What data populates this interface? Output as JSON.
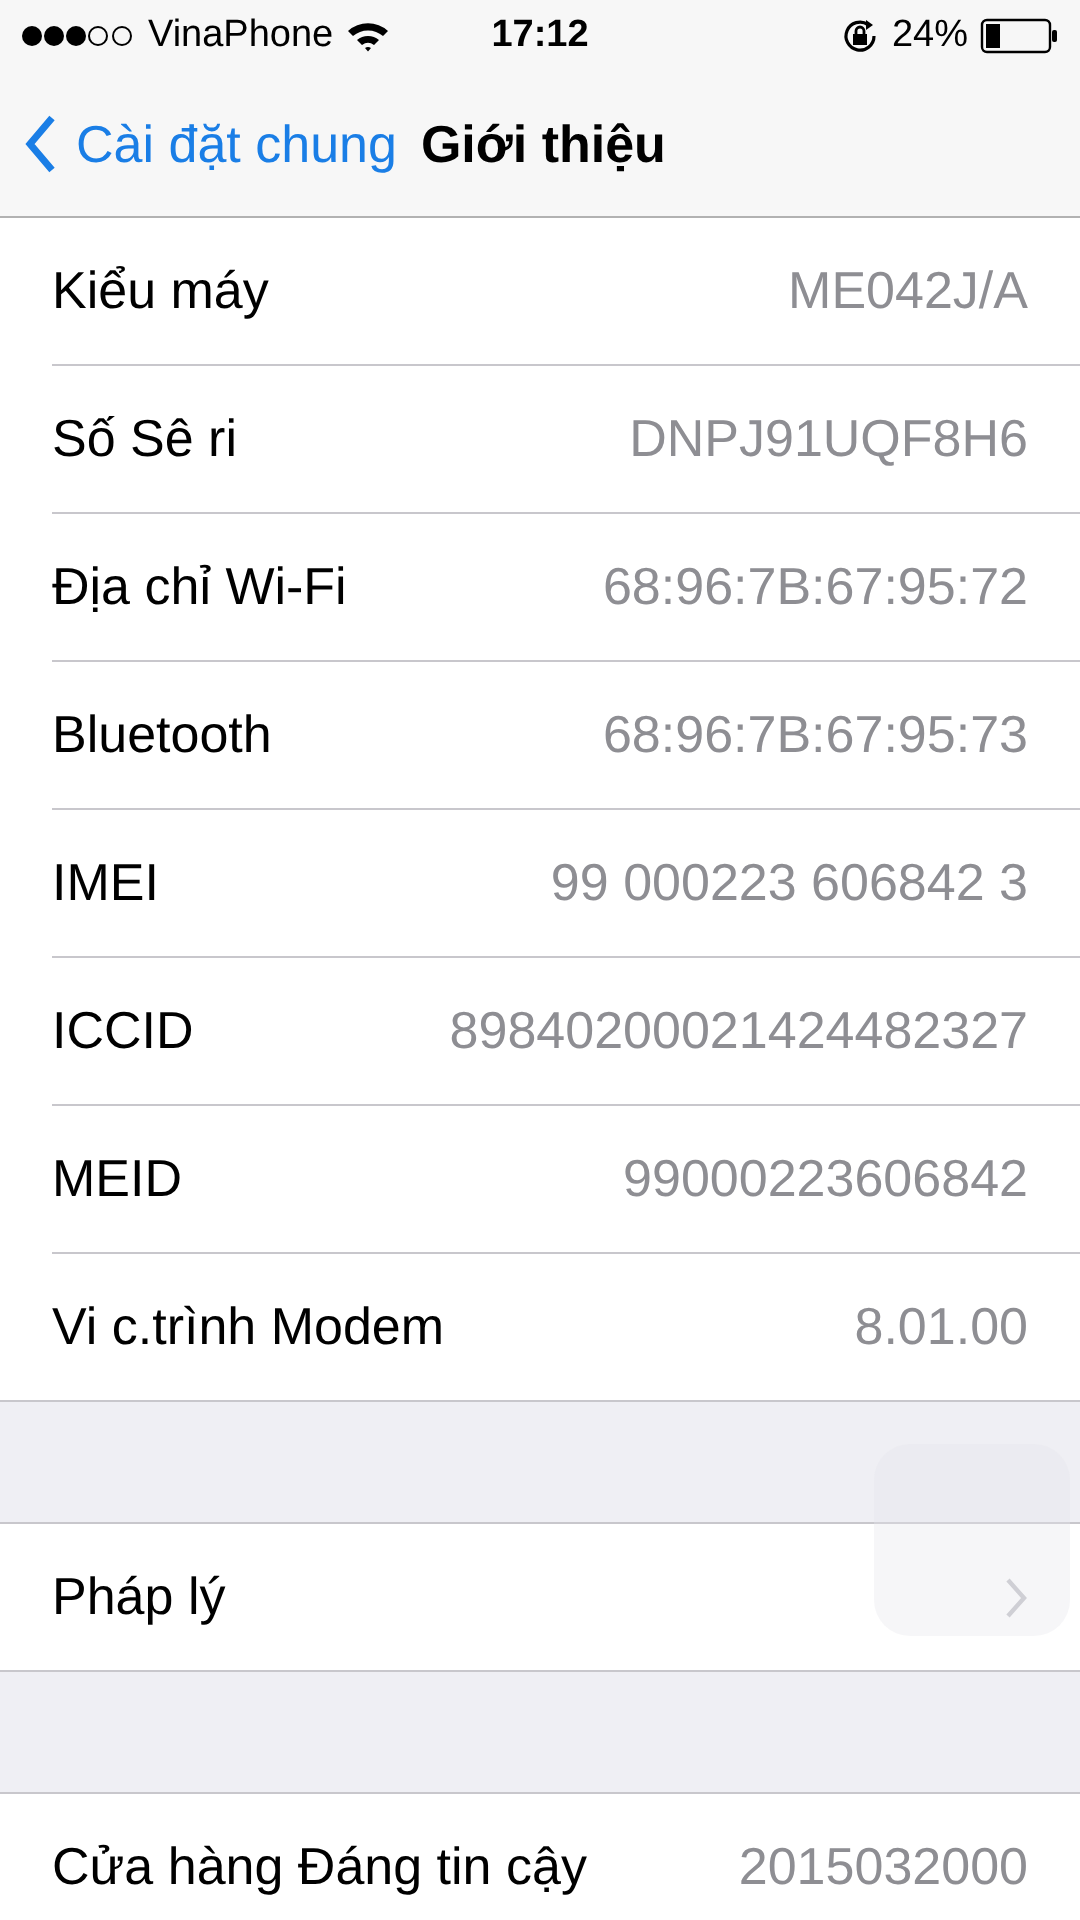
{
  "status_bar": {
    "carrier": "VinaPhone",
    "time": "17:12",
    "battery": "24%"
  },
  "nav": {
    "back": "Cài đặt chung",
    "title": "Giới thiệu"
  },
  "sections": [
    {
      "rows": [
        {
          "kind": "value",
          "label": "Kiểu máy",
          "value": "ME042J/A"
        },
        {
          "kind": "value",
          "label": "Số Sê ri",
          "value": "DNPJ91UQF8H6"
        },
        {
          "kind": "value",
          "label": "Địa chỉ Wi-Fi",
          "value": "68:96:7B:67:95:72"
        },
        {
          "kind": "value",
          "label": "Bluetooth",
          "value": "68:96:7B:67:95:73"
        },
        {
          "kind": "value",
          "label": "IMEI",
          "value": "99 000223 606842 3"
        },
        {
          "kind": "value",
          "label": "ICCID",
          "value": "89840200021424482327"
        },
        {
          "kind": "value",
          "label": "MEID",
          "value": "99000223606842"
        },
        {
          "kind": "value",
          "label": "Vi c.trình Modem",
          "value": "8.01.00"
        }
      ]
    },
    {
      "rows": [
        {
          "kind": "link",
          "label": "Pháp lý"
        }
      ]
    },
    {
      "rows": [
        {
          "kind": "value",
          "label": "Cửa hàng Đáng tin cậy",
          "value": "2015032000"
        }
      ]
    }
  ]
}
